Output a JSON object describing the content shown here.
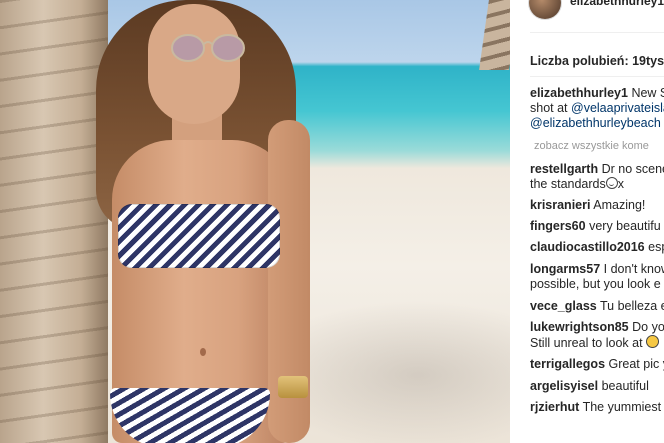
{
  "post": {
    "photo_alt": "photo",
    "author": "elizabethhurley1",
    "likes_text": "Liczba polubień: 19tys.",
    "caption": {
      "user": "elizabethhurley1",
      "line1_text": "New S",
      "line2_prefix": "shot at ",
      "line2_mention": "@velaaprivateisla",
      "line3_mention": "@elizabethhurleybeach"
    },
    "view_all_comments": "zobacz wszystkie kome"
  },
  "comments": [
    {
      "user": "restellgarth",
      "text": "Dr no scene",
      "line2": "the standards",
      "emoji_after_line2": "smile-outline",
      "line2_tail": "x"
    },
    {
      "user": "krisranieri",
      "text": "Amazing!"
    },
    {
      "user": "fingers60",
      "text": "very beautifu"
    },
    {
      "user": "claudiocastillo2016",
      "text": "esp"
    },
    {
      "user": "longarms57",
      "text": "I don't know",
      "line2": "possible, but you look e"
    },
    {
      "user": "vece_glass",
      "text": "Tu belleza e"
    },
    {
      "user": "lukewrightson85",
      "text": "Do yo",
      "line2": "Still unreal to look at",
      "emoji_after_line2": "grin-yellow"
    },
    {
      "user": "terrigallegos",
      "text": "Great pic y"
    },
    {
      "user": "argelisyisel",
      "text": "beautiful"
    },
    {
      "user": "rjzierhut",
      "text": "The yummiest"
    }
  ],
  "colors": {
    "text": "#262626",
    "link": "#003569",
    "muted": "#999999",
    "divider": "#efefef"
  }
}
